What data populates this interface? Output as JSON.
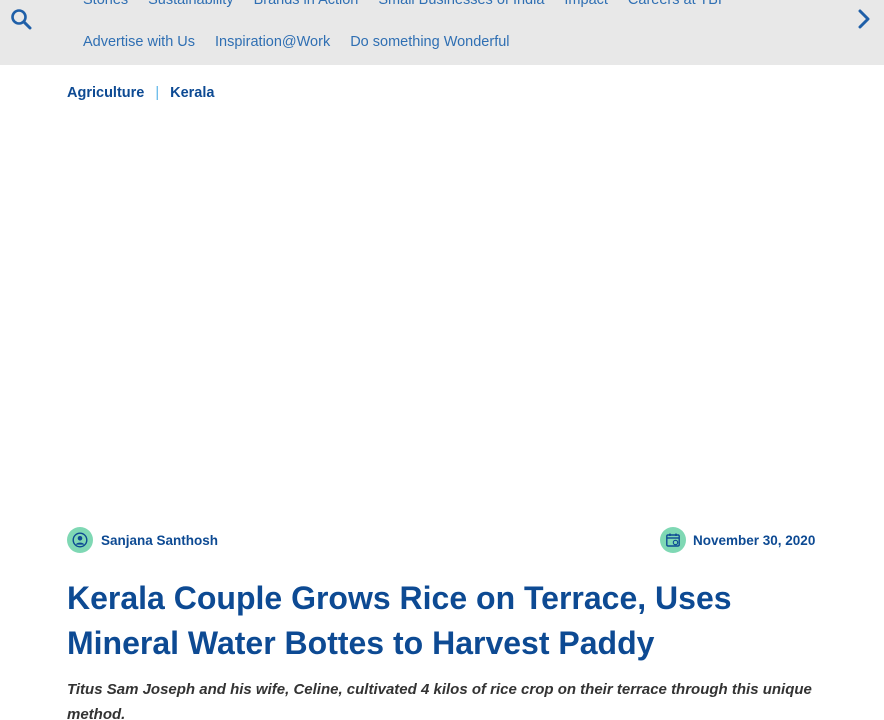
{
  "nav": {
    "row1": [
      "Stories",
      "Sustainability",
      "Brands in Action",
      "Small Businesses of India",
      "Impact",
      "Careers at TBI"
    ],
    "row2": [
      "Advertise with Us",
      "Inspiration@Work",
      "Do something Wonderful"
    ]
  },
  "icons": {
    "search": "search-icon",
    "next": "chevron-right-icon",
    "author": "user-circle-icon",
    "date": "calendar-icon"
  },
  "colors": {
    "brand_blue": "#0d4a93",
    "nav_blue": "#2f6fb3",
    "accent_green": "#7fd8b4",
    "separator": "#5ab4e8",
    "topbar_bg": "#e8e8e8"
  },
  "breadcrumb": {
    "items": [
      "Agriculture",
      "Kerala"
    ],
    "separator": "|"
  },
  "article": {
    "author": "Sanjana Santhosh",
    "date": "November 30, 2020",
    "title": "Kerala Couple Grows Rice on Terrace, Uses Mineral Water Bottes to Harvest Paddy",
    "summary": "Titus Sam Joseph and his wife, Celine, cultivated 4 kilos of rice crop on their terrace through this unique method."
  }
}
